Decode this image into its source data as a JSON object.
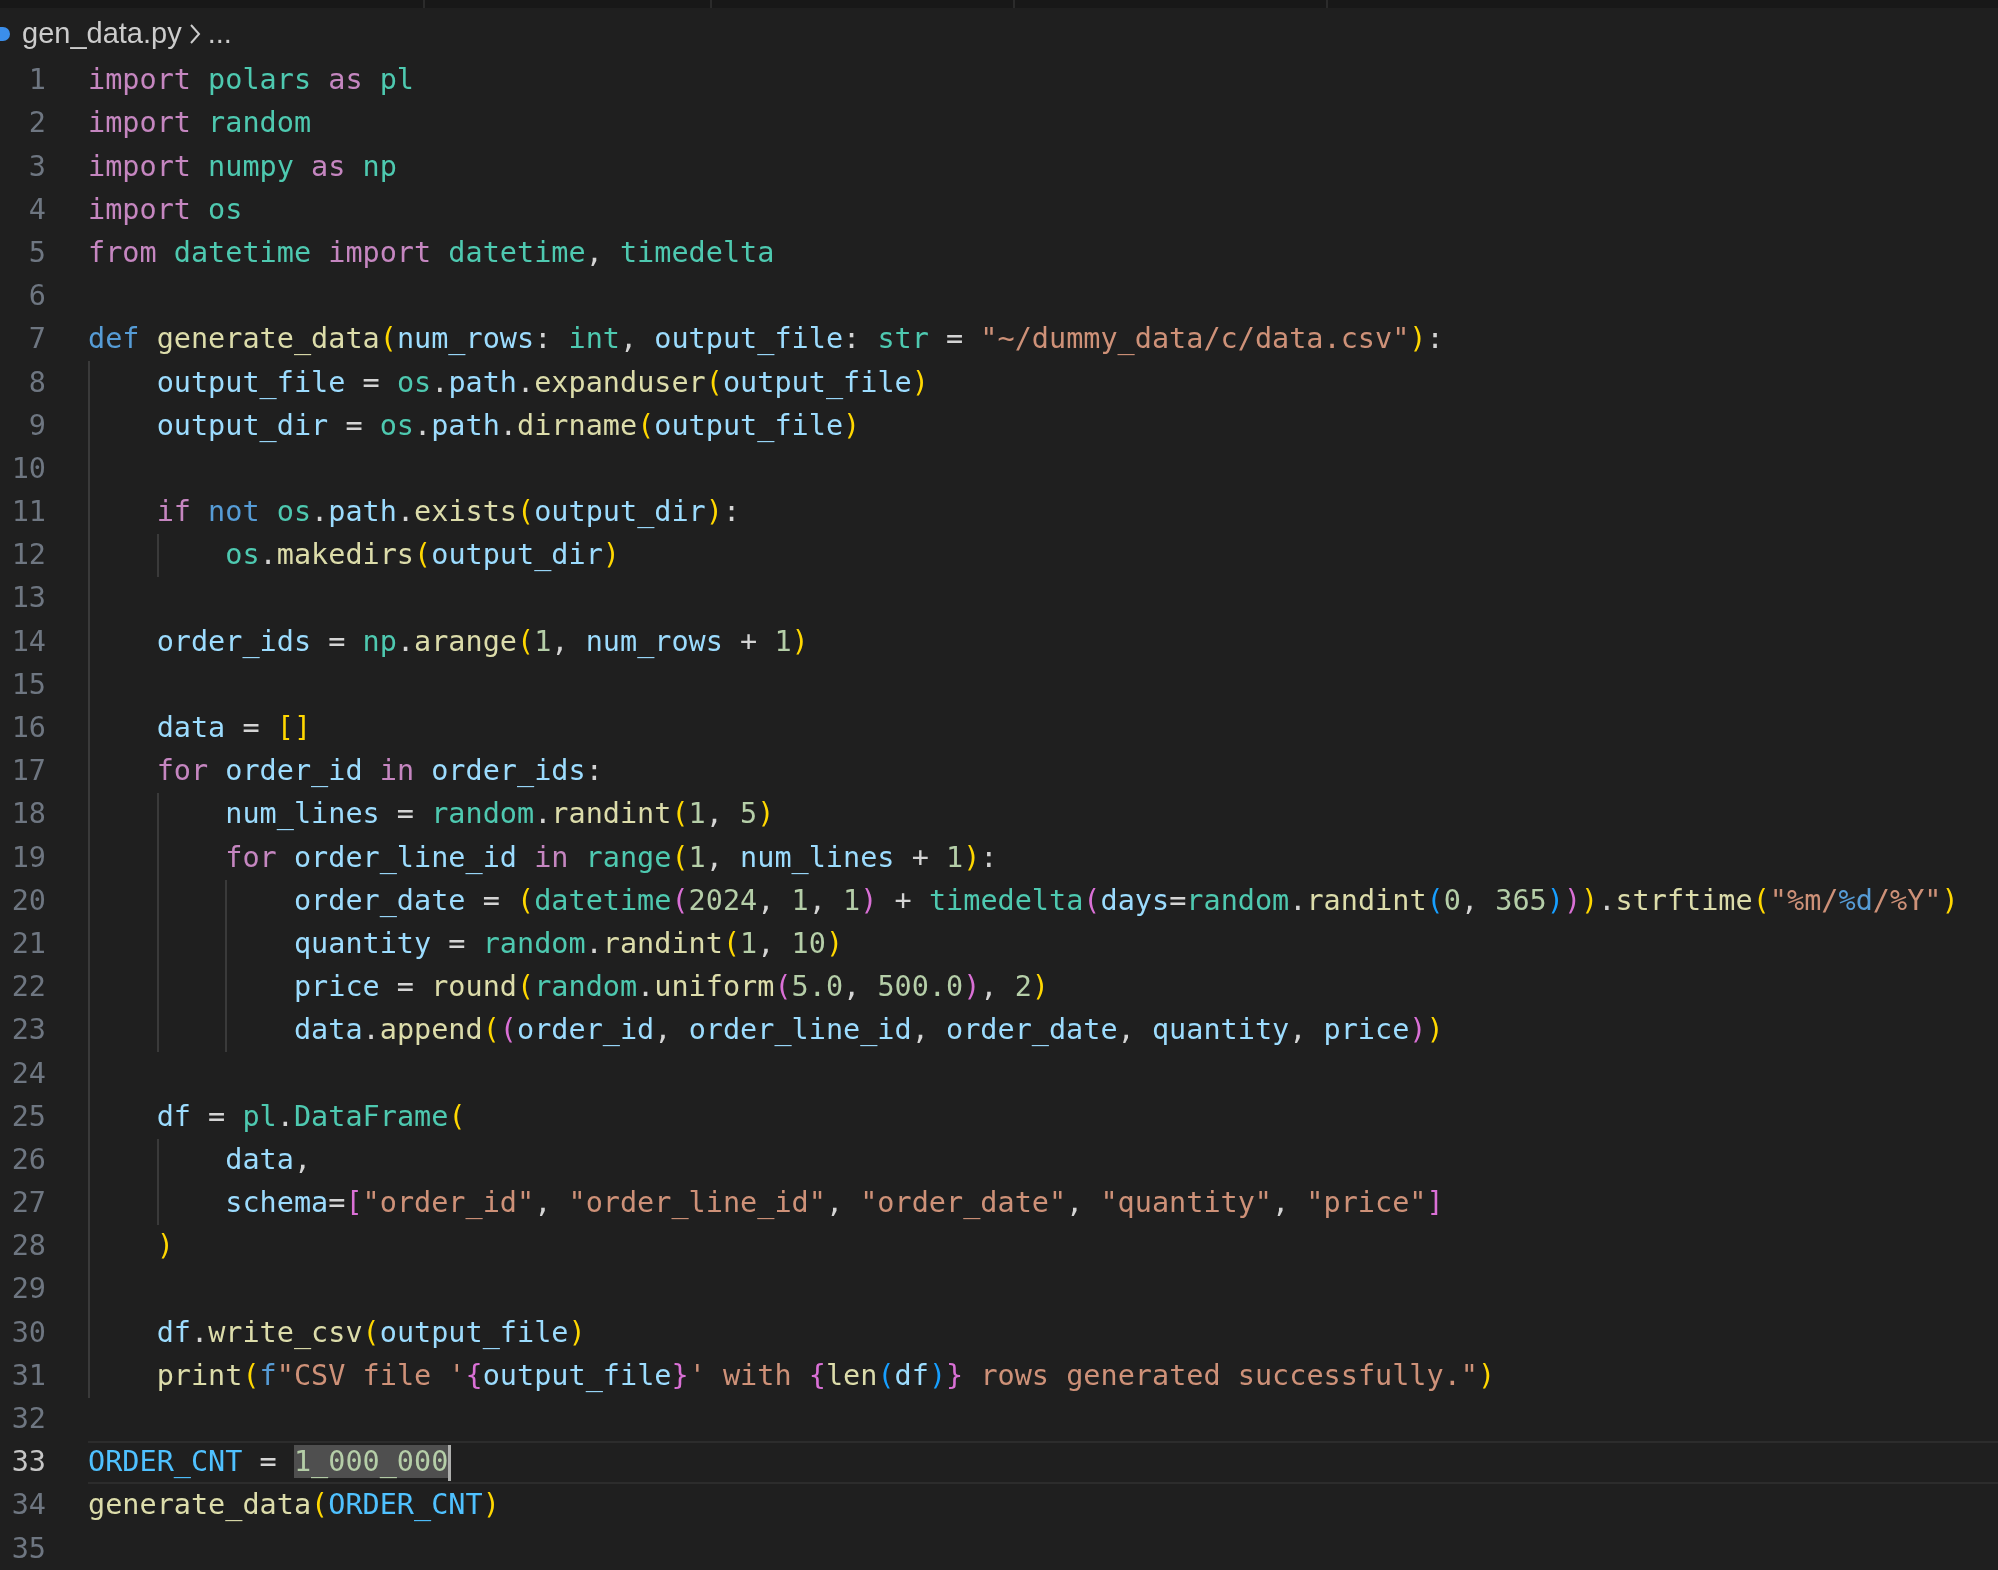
{
  "breadcrumb": {
    "file": "gen_data.py",
    "rest": "..."
  },
  "editor": {
    "lines": [
      {
        "number": "1",
        "current": false,
        "tokens": [
          {
            "kind": "kw",
            "text": "import "
          },
          {
            "kind": "mod",
            "text": "polars "
          },
          {
            "kind": "kw",
            "text": "as "
          },
          {
            "kind": "mod",
            "text": "pl"
          }
        ]
      },
      {
        "number": "2",
        "current": false,
        "tokens": [
          {
            "kind": "kw",
            "text": "import "
          },
          {
            "kind": "mod",
            "text": "random"
          }
        ]
      },
      {
        "number": "3",
        "current": false,
        "tokens": [
          {
            "kind": "kw",
            "text": "import "
          },
          {
            "kind": "mod",
            "text": "numpy "
          },
          {
            "kind": "kw",
            "text": "as "
          },
          {
            "kind": "mod",
            "text": "np"
          }
        ]
      },
      {
        "number": "4",
        "current": false,
        "tokens": [
          {
            "kind": "kw",
            "text": "import "
          },
          {
            "kind": "mod",
            "text": "os"
          }
        ]
      },
      {
        "number": "5",
        "current": false,
        "tokens": [
          {
            "kind": "kw",
            "text": "from "
          },
          {
            "kind": "mod",
            "text": "datetime "
          },
          {
            "kind": "kw",
            "text": "import "
          },
          {
            "kind": "mod",
            "text": "datetime"
          },
          {
            "kind": "p",
            "text": ", "
          },
          {
            "kind": "mod",
            "text": "timedelta"
          }
        ]
      },
      {
        "number": "6",
        "current": false
      },
      {
        "number": "7",
        "current": false,
        "tokens": [
          {
            "kind": "st",
            "text": "def "
          },
          {
            "kind": "fn",
            "text": "generate_data"
          },
          {
            "kind": "b1",
            "text": "("
          },
          {
            "kind": "var",
            "text": "num_rows"
          },
          {
            "kind": "p",
            "text": ": "
          },
          {
            "kind": "mod",
            "text": "int"
          },
          {
            "kind": "p",
            "text": ", "
          },
          {
            "kind": "var",
            "text": "output_file"
          },
          {
            "kind": "p",
            "text": ": "
          },
          {
            "kind": "mod",
            "text": "str"
          },
          {
            "kind": "p",
            "text": " = "
          },
          {
            "kind": "str",
            "text": "\"~/dummy_data/c/data.csv\""
          },
          {
            "kind": "b1",
            "text": ")"
          },
          {
            "kind": "p",
            "text": ":"
          }
        ]
      },
      {
        "number": "8",
        "current": false,
        "tokens": [
          {
            "kind": "var",
            "text": "    output_file"
          },
          {
            "kind": "p",
            "text": " = "
          },
          {
            "kind": "mod",
            "text": "os"
          },
          {
            "kind": "p",
            "text": "."
          },
          {
            "kind": "var",
            "text": "path"
          },
          {
            "kind": "p",
            "text": "."
          },
          {
            "kind": "fn",
            "text": "expanduser"
          },
          {
            "kind": "b1",
            "text": "("
          },
          {
            "kind": "var",
            "text": "output_file"
          },
          {
            "kind": "b1",
            "text": ")"
          }
        ]
      },
      {
        "number": "9",
        "current": false,
        "tokens": [
          {
            "kind": "var",
            "text": "    output_dir"
          },
          {
            "kind": "p",
            "text": " = "
          },
          {
            "kind": "mod",
            "text": "os"
          },
          {
            "kind": "p",
            "text": "."
          },
          {
            "kind": "var",
            "text": "path"
          },
          {
            "kind": "p",
            "text": "."
          },
          {
            "kind": "fn",
            "text": "dirname"
          },
          {
            "kind": "b1",
            "text": "("
          },
          {
            "kind": "var",
            "text": "output_file"
          },
          {
            "kind": "b1",
            "text": ")"
          }
        ]
      },
      {
        "number": "10",
        "current": false
      },
      {
        "number": "11",
        "current": false,
        "tokens": [
          {
            "kind": "kw",
            "text": "    if "
          },
          {
            "kind": "st",
            "text": "not "
          },
          {
            "kind": "mod",
            "text": "os"
          },
          {
            "kind": "p",
            "text": "."
          },
          {
            "kind": "var",
            "text": "path"
          },
          {
            "kind": "p",
            "text": "."
          },
          {
            "kind": "fn",
            "text": "exists"
          },
          {
            "kind": "b1",
            "text": "("
          },
          {
            "kind": "var",
            "text": "output_dir"
          },
          {
            "kind": "b1",
            "text": ")"
          },
          {
            "kind": "p",
            "text": ":"
          }
        ]
      },
      {
        "number": "12",
        "current": false,
        "tokens": [
          {
            "kind": "mod",
            "text": "        os"
          },
          {
            "kind": "p",
            "text": "."
          },
          {
            "kind": "fn",
            "text": "makedirs"
          },
          {
            "kind": "b1",
            "text": "("
          },
          {
            "kind": "var",
            "text": "output_dir"
          },
          {
            "kind": "b1",
            "text": ")"
          }
        ]
      },
      {
        "number": "13",
        "current": false
      },
      {
        "number": "14",
        "current": false,
        "tokens": [
          {
            "kind": "var",
            "text": "    order_ids"
          },
          {
            "kind": "p",
            "text": " = "
          },
          {
            "kind": "mod",
            "text": "np"
          },
          {
            "kind": "p",
            "text": "."
          },
          {
            "kind": "fn",
            "text": "arange"
          },
          {
            "kind": "b1",
            "text": "("
          },
          {
            "kind": "num",
            "text": "1"
          },
          {
            "kind": "p",
            "text": ", "
          },
          {
            "kind": "var",
            "text": "num_rows"
          },
          {
            "kind": "p",
            "text": " + "
          },
          {
            "kind": "num",
            "text": "1"
          },
          {
            "kind": "b1",
            "text": ")"
          }
        ]
      },
      {
        "number": "15",
        "current": false
      },
      {
        "number": "16",
        "current": false,
        "tokens": [
          {
            "kind": "var",
            "text": "    data"
          },
          {
            "kind": "p",
            "text": " = "
          },
          {
            "kind": "b1",
            "text": "[]"
          }
        ]
      },
      {
        "number": "17",
        "current": false,
        "tokens": [
          {
            "kind": "kw",
            "text": "    for "
          },
          {
            "kind": "var",
            "text": "order_id "
          },
          {
            "kind": "kw",
            "text": "in "
          },
          {
            "kind": "var",
            "text": "order_ids"
          },
          {
            "kind": "p",
            "text": ":"
          }
        ]
      },
      {
        "number": "18",
        "current": false,
        "tokens": [
          {
            "kind": "var",
            "text": "        num_lines"
          },
          {
            "kind": "p",
            "text": " = "
          },
          {
            "kind": "mod",
            "text": "random"
          },
          {
            "kind": "p",
            "text": "."
          },
          {
            "kind": "fn",
            "text": "randint"
          },
          {
            "kind": "b1",
            "text": "("
          },
          {
            "kind": "num",
            "text": "1"
          },
          {
            "kind": "p",
            "text": ", "
          },
          {
            "kind": "num",
            "text": "5"
          },
          {
            "kind": "b1",
            "text": ")"
          }
        ]
      },
      {
        "number": "19",
        "current": false,
        "tokens": [
          {
            "kind": "kw",
            "text": "        for "
          },
          {
            "kind": "var",
            "text": "order_line_id "
          },
          {
            "kind": "kw",
            "text": "in "
          },
          {
            "kind": "mod",
            "text": "range"
          },
          {
            "kind": "b1",
            "text": "("
          },
          {
            "kind": "num",
            "text": "1"
          },
          {
            "kind": "p",
            "text": ", "
          },
          {
            "kind": "var",
            "text": "num_lines"
          },
          {
            "kind": "p",
            "text": " + "
          },
          {
            "kind": "num",
            "text": "1"
          },
          {
            "kind": "b1",
            "text": ")"
          },
          {
            "kind": "p",
            "text": ":"
          }
        ]
      },
      {
        "number": "20",
        "current": false,
        "tokens": [
          {
            "kind": "var",
            "text": "            order_date"
          },
          {
            "kind": "p",
            "text": " = "
          },
          {
            "kind": "b1",
            "text": "("
          },
          {
            "kind": "mod",
            "text": "datetime"
          },
          {
            "kind": "b2",
            "text": "("
          },
          {
            "kind": "num",
            "text": "2024"
          },
          {
            "kind": "p",
            "text": ", "
          },
          {
            "kind": "num",
            "text": "1"
          },
          {
            "kind": "p",
            "text": ", "
          },
          {
            "kind": "num",
            "text": "1"
          },
          {
            "kind": "b2",
            "text": ")"
          },
          {
            "kind": "p",
            "text": " + "
          },
          {
            "kind": "mod",
            "text": "timedelta"
          },
          {
            "kind": "b2",
            "text": "("
          },
          {
            "kind": "var",
            "text": "days"
          },
          {
            "kind": "p",
            "text": "="
          },
          {
            "kind": "mod",
            "text": "random"
          },
          {
            "kind": "p",
            "text": "."
          },
          {
            "kind": "fn",
            "text": "randint"
          },
          {
            "kind": "b3",
            "text": "("
          },
          {
            "kind": "num",
            "text": "0"
          },
          {
            "kind": "p",
            "text": ", "
          },
          {
            "kind": "num",
            "text": "365"
          },
          {
            "kind": "b3",
            "text": ")"
          },
          {
            "kind": "b2",
            "text": ")"
          },
          {
            "kind": "b1",
            "text": ")"
          },
          {
            "kind": "p",
            "text": "."
          },
          {
            "kind": "fn",
            "text": "strftime"
          },
          {
            "kind": "b1",
            "text": "("
          },
          {
            "kind": "str",
            "text": "\"%m/"
          },
          {
            "kind": "st",
            "text": "%d"
          },
          {
            "kind": "str",
            "text": "/%Y\""
          },
          {
            "kind": "b1",
            "text": ")"
          }
        ]
      },
      {
        "number": "21",
        "current": false,
        "tokens": [
          {
            "kind": "var",
            "text": "            quantity"
          },
          {
            "kind": "p",
            "text": " = "
          },
          {
            "kind": "mod",
            "text": "random"
          },
          {
            "kind": "p",
            "text": "."
          },
          {
            "kind": "fn",
            "text": "randint"
          },
          {
            "kind": "b1",
            "text": "("
          },
          {
            "kind": "num",
            "text": "1"
          },
          {
            "kind": "p",
            "text": ", "
          },
          {
            "kind": "num",
            "text": "10"
          },
          {
            "kind": "b1",
            "text": ")"
          }
        ]
      },
      {
        "number": "22",
        "current": false,
        "tokens": [
          {
            "kind": "var",
            "text": "            price"
          },
          {
            "kind": "p",
            "text": " = "
          },
          {
            "kind": "fn",
            "text": "round"
          },
          {
            "kind": "b1",
            "text": "("
          },
          {
            "kind": "mod",
            "text": "random"
          },
          {
            "kind": "p",
            "text": "."
          },
          {
            "kind": "fn",
            "text": "uniform"
          },
          {
            "kind": "b2",
            "text": "("
          },
          {
            "kind": "num",
            "text": "5.0"
          },
          {
            "kind": "p",
            "text": ", "
          },
          {
            "kind": "num",
            "text": "500.0"
          },
          {
            "kind": "b2",
            "text": ")"
          },
          {
            "kind": "p",
            "text": ", "
          },
          {
            "kind": "num",
            "text": "2"
          },
          {
            "kind": "b1",
            "text": ")"
          }
        ]
      },
      {
        "number": "23",
        "current": false,
        "tokens": [
          {
            "kind": "var",
            "text": "            data"
          },
          {
            "kind": "p",
            "text": "."
          },
          {
            "kind": "fn",
            "text": "append"
          },
          {
            "kind": "b1",
            "text": "("
          },
          {
            "kind": "b2",
            "text": "("
          },
          {
            "kind": "var",
            "text": "order_id"
          },
          {
            "kind": "p",
            "text": ", "
          },
          {
            "kind": "var",
            "text": "order_line_id"
          },
          {
            "kind": "p",
            "text": ", "
          },
          {
            "kind": "var",
            "text": "order_date"
          },
          {
            "kind": "p",
            "text": ", "
          },
          {
            "kind": "var",
            "text": "quantity"
          },
          {
            "kind": "p",
            "text": ", "
          },
          {
            "kind": "var",
            "text": "price"
          },
          {
            "kind": "b2",
            "text": ")"
          },
          {
            "kind": "b1",
            "text": ")"
          }
        ]
      },
      {
        "number": "24",
        "current": false
      },
      {
        "number": "25",
        "current": false,
        "tokens": [
          {
            "kind": "var",
            "text": "    df"
          },
          {
            "kind": "p",
            "text": " = "
          },
          {
            "kind": "mod",
            "text": "pl"
          },
          {
            "kind": "p",
            "text": "."
          },
          {
            "kind": "mod",
            "text": "DataFrame"
          },
          {
            "kind": "b1",
            "text": "("
          }
        ]
      },
      {
        "number": "26",
        "current": false,
        "tokens": [
          {
            "kind": "var",
            "text": "        data"
          },
          {
            "kind": "p",
            "text": ","
          }
        ]
      },
      {
        "number": "27",
        "current": false,
        "tokens": [
          {
            "kind": "var",
            "text": "        schema"
          },
          {
            "kind": "p",
            "text": "="
          },
          {
            "kind": "b2",
            "text": "["
          },
          {
            "kind": "str",
            "text": "\"order_id\""
          },
          {
            "kind": "p",
            "text": ", "
          },
          {
            "kind": "str",
            "text": "\"order_line_id\""
          },
          {
            "kind": "p",
            "text": ", "
          },
          {
            "kind": "str",
            "text": "\"order_date\""
          },
          {
            "kind": "p",
            "text": ", "
          },
          {
            "kind": "str",
            "text": "\"quantity\""
          },
          {
            "kind": "p",
            "text": ", "
          },
          {
            "kind": "str",
            "text": "\"price\""
          },
          {
            "kind": "b2",
            "text": "]"
          }
        ]
      },
      {
        "number": "28",
        "current": false,
        "tokens": [
          {
            "kind": "b1",
            "text": "    )"
          }
        ]
      },
      {
        "number": "29",
        "current": false
      },
      {
        "number": "30",
        "current": false,
        "tokens": [
          {
            "kind": "var",
            "text": "    df"
          },
          {
            "kind": "p",
            "text": "."
          },
          {
            "kind": "fn",
            "text": "write_csv"
          },
          {
            "kind": "b1",
            "text": "("
          },
          {
            "kind": "var",
            "text": "output_file"
          },
          {
            "kind": "b1",
            "text": ")"
          }
        ]
      },
      {
        "number": "31",
        "current": false,
        "tokens": [
          {
            "kind": "fn",
            "text": "    print"
          },
          {
            "kind": "b1",
            "text": "("
          },
          {
            "kind": "st",
            "text": "f"
          },
          {
            "kind": "str",
            "text": "\"CSV file '"
          },
          {
            "kind": "b2",
            "text": "{"
          },
          {
            "kind": "var",
            "text": "output_file"
          },
          {
            "kind": "b2",
            "text": "}"
          },
          {
            "kind": "str",
            "text": "' with "
          },
          {
            "kind": "b2",
            "text": "{"
          },
          {
            "kind": "fn",
            "text": "len"
          },
          {
            "kind": "b3",
            "text": "("
          },
          {
            "kind": "var",
            "text": "df"
          },
          {
            "kind": "b3",
            "text": ")"
          },
          {
            "kind": "b2",
            "text": "}"
          },
          {
            "kind": "str",
            "text": " rows generated successfully.\""
          },
          {
            "kind": "b1",
            "text": ")"
          }
        ]
      },
      {
        "number": "32",
        "current": false
      },
      {
        "number": "33",
        "current": true,
        "tokens": [
          {
            "kind": "const",
            "text": "ORDER_CNT"
          },
          {
            "kind": "p",
            "text": " = "
          },
          {
            "kind": "sel",
            "text": "1_000_000"
          }
        ]
      },
      {
        "number": "34",
        "current": false,
        "tokens": [
          {
            "kind": "fn",
            "text": "generate_data"
          },
          {
            "kind": "b1",
            "text": "("
          },
          {
            "kind": "const",
            "text": "ORDER_CNT"
          },
          {
            "kind": "b1",
            "text": ")"
          }
        ]
      },
      {
        "number": "35",
        "current": false
      }
    ]
  }
}
